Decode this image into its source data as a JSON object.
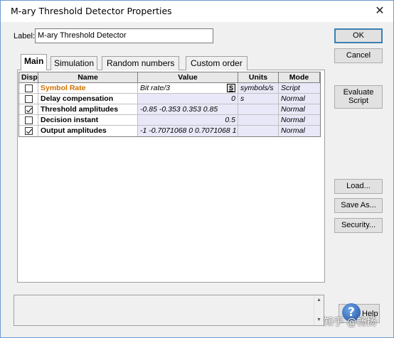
{
  "window": {
    "title": "M-ary Threshold Detector Properties",
    "close_glyph": "✕"
  },
  "label_field": {
    "label": "Label:",
    "value": "M-ary Threshold Detector"
  },
  "buttons": {
    "ok": "OK",
    "cancel": "Cancel",
    "evaluate_script": "Evaluate Script",
    "load": "Load...",
    "save_as": "Save As...",
    "security": "Security...",
    "help": "Help",
    "script_s": "S"
  },
  "tabs": [
    {
      "label": "Main",
      "active": true
    },
    {
      "label": "Simulation",
      "active": false
    },
    {
      "label": "Random numbers",
      "active": false
    },
    {
      "label": "Custom order",
      "active": false
    }
  ],
  "grid": {
    "headers": [
      "Disp",
      "Name",
      "Value",
      "Units",
      "Mode"
    ],
    "rows": [
      {
        "disp": false,
        "name": "Symbol Rate",
        "value": "Bit rate/3",
        "units": "symbols/s",
        "mode": "Script"
      },
      {
        "disp": false,
        "name": "Delay compensation",
        "value": "0",
        "units": "s",
        "mode": "Normal"
      },
      {
        "disp": true,
        "name": "Threshold amplitudes",
        "value": "-0.85 -0.353 0.353 0.85",
        "units": "",
        "mode": "Normal"
      },
      {
        "disp": false,
        "name": "Decision instant",
        "value": "0.5",
        "units": "",
        "mode": "Normal"
      },
      {
        "disp": true,
        "name": "Output amplitudes",
        "value": "-1 -0.7071068 0 0.7071068 1",
        "units": "",
        "mode": "Normal"
      }
    ]
  },
  "watermark": "知乎 @畅扬",
  "colors": {
    "accent_name": "#d07000",
    "default_button_border": "#3c7fb1",
    "value_bg": "#e8e8f8"
  },
  "icons": {
    "help": "help-icon",
    "close": "close-icon"
  }
}
